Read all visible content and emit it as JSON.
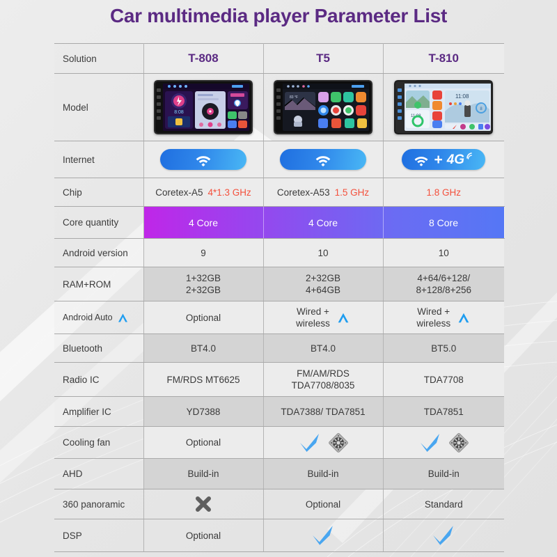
{
  "title": "Car multimedia player Parameter List",
  "colors": {
    "title_purple": "#5b2a83",
    "accent_red": "#f4503c",
    "wifi_blue": "#2f86ea",
    "check_blue": "#49a6f0",
    "gradient_start": "#c026e8",
    "gradient_end": "#5577f5",
    "row_dark": "#d4d4d4",
    "row_light": "#ececec"
  },
  "columns": [
    "Solution",
    "T-808",
    "T5",
    "T-810"
  ],
  "rows": [
    {
      "label": "Model",
      "type": "image",
      "values": [
        "car-head-unit-t808",
        "car-head-unit-t5",
        "car-head-unit-t810"
      ]
    },
    {
      "label": "Internet",
      "type": "pill",
      "values": [
        "wifi-icon",
        "wifi-icon",
        "wifi-plus-4g"
      ],
      "badge_text": "4G"
    },
    {
      "label": "Chip",
      "type": "chip",
      "values": [
        {
          "name": "Coretex-A5",
          "speed": "4*1.3 GHz"
        },
        {
          "name": "Coretex-A53",
          "speed": "1.5 GHz"
        },
        {
          "name": "",
          "speed": "1.8 GHz"
        }
      ]
    },
    {
      "label": "Core quantity",
      "type": "gradient",
      "values": [
        "4 Core",
        "4 Core",
        "8 Core"
      ]
    },
    {
      "label": "Android version",
      "type": "text",
      "values": [
        "9",
        "10",
        "10"
      ]
    },
    {
      "label": "RAM+ROM",
      "type": "text2",
      "values": [
        [
          "1+32GB",
          "2+32GB"
        ],
        [
          "2+32GB",
          "4+64GB"
        ],
        [
          "4+64/6+128/",
          "8+128/8+256"
        ]
      ]
    },
    {
      "label": "Android Auto",
      "type": "androidauto",
      "values": [
        {
          "lines": [
            "Optional"
          ],
          "icon": false
        },
        {
          "lines": [
            "Wired +",
            "wireless"
          ],
          "icon": true
        },
        {
          "lines": [
            "Wired +",
            "wireless"
          ],
          "icon": true
        }
      ]
    },
    {
      "label": "Bluetooth",
      "type": "text",
      "values": [
        "BT4.0",
        "BT4.0",
        "BT5.0"
      ]
    },
    {
      "label": "Radio IC",
      "type": "text2",
      "values": [
        [
          "FM/RDS MT6625",
          ""
        ],
        [
          "FM/AM/RDS",
          "TDA7708/8035"
        ],
        [
          "TDA7708",
          ""
        ]
      ]
    },
    {
      "label": "Amplifier IC",
      "type": "text",
      "values": [
        "YD7388",
        "TDA7388/ TDA7851",
        "TDA7851"
      ]
    },
    {
      "label": "Cooling fan",
      "type": "fan",
      "values": [
        "Optional",
        "check-fan",
        "check-fan"
      ]
    },
    {
      "label": "AHD",
      "type": "text",
      "values": [
        "Build-in",
        "Build-in",
        "Build-in"
      ]
    },
    {
      "label": "360 panoramic",
      "type": "mixed",
      "values": [
        "cross-icon",
        "Optional",
        "Standard"
      ]
    },
    {
      "label": "DSP",
      "type": "mixed",
      "values": [
        "Optional",
        "check-icon",
        "check-icon"
      ]
    }
  ]
}
